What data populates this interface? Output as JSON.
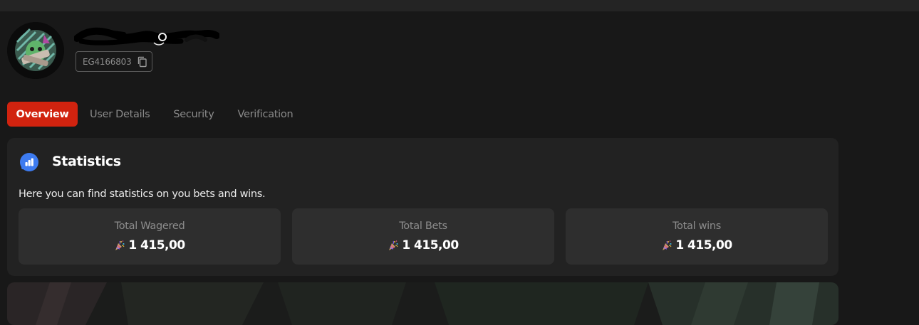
{
  "profile": {
    "user_id": "EG4166803",
    "avatar_icon": "avatar-artwork",
    "copy_icon": "copy-icon"
  },
  "tabs": [
    {
      "label": "Overview",
      "active": true
    },
    {
      "label": "User Details",
      "active": false
    },
    {
      "label": "Security",
      "active": false
    },
    {
      "label": "Verification",
      "active": false
    }
  ],
  "statistics": {
    "title": "Statistics",
    "description": "Here you can find statistics on you bets and wins.",
    "icon": "chart-bubble-icon",
    "cards": [
      {
        "label": "Total Wagered",
        "value": "1 415,00",
        "icon": "party-popper-icon"
      },
      {
        "label": "Total Bets",
        "value": "1 415,00",
        "icon": "party-popper-icon"
      },
      {
        "label": "Total wins",
        "value": "1 415,00",
        "icon": "party-popper-icon"
      }
    ]
  },
  "colors": {
    "accent": "#d1230f",
    "background": "#181818",
    "panel": "#222222",
    "card": "#2e2e2e",
    "stats_icon_blue": "#3d7bf0"
  }
}
